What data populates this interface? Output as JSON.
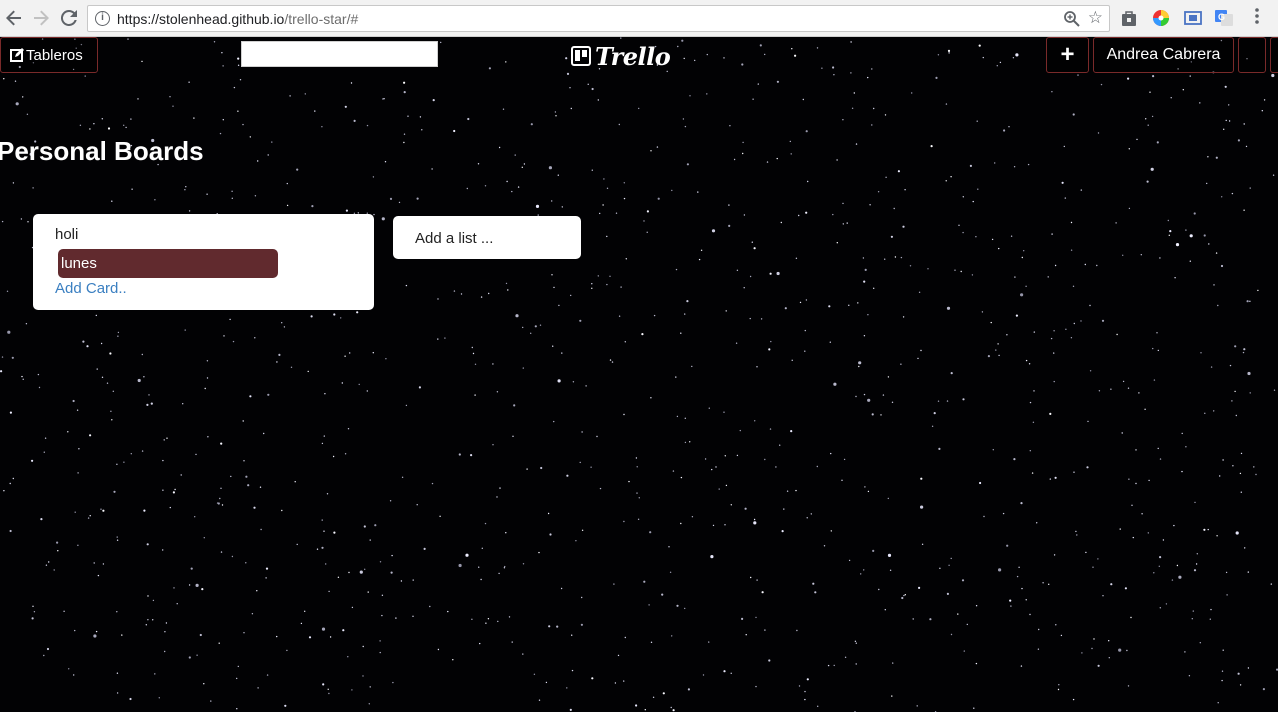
{
  "browser": {
    "url_host": "https://stolenhead.github.io",
    "url_path": "/trello-star/#"
  },
  "topbar": {
    "boards_label": "Tableros",
    "logo_text": "Trello",
    "add_label": "+",
    "user_name": "Andrea Cabrera",
    "accent_color": "#7a2a2a"
  },
  "board": {
    "title": "Personal Boards",
    "lists": [
      {
        "title": "holi",
        "cards": [
          "lunes"
        ],
        "add_card_label": "Add Card.."
      }
    ],
    "add_list_label": "Add a list ..."
  },
  "colors": {
    "card_bg": "#612a2e",
    "link": "#3a7fc1",
    "background": "#000000"
  }
}
